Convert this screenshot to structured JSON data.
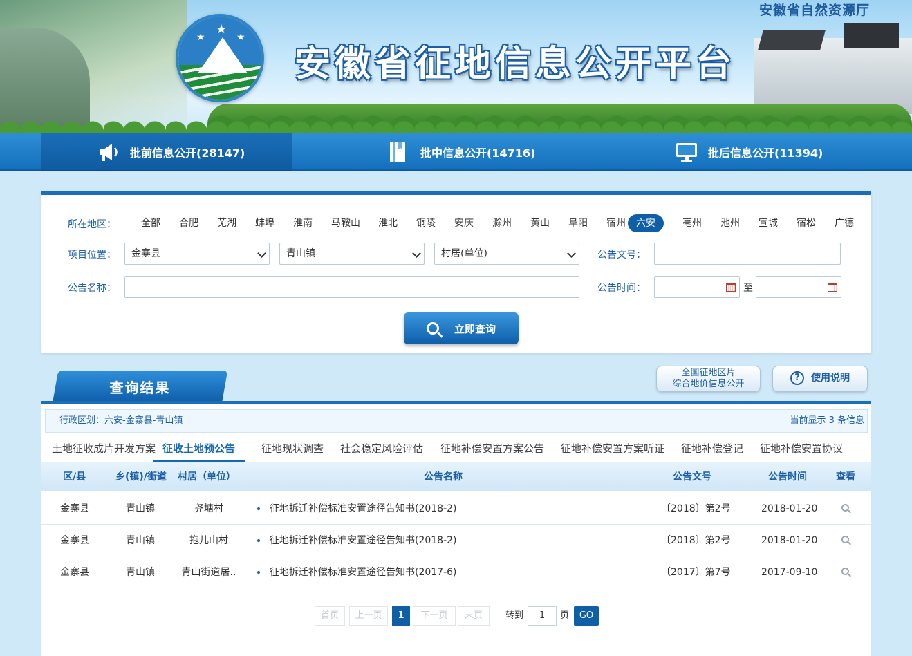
{
  "header": {
    "department": "安徽省自然资源厅",
    "site_title": "安徽省征地信息公开平台"
  },
  "nav": [
    {
      "label": "批前信息公开(28147)",
      "icon": "megaphone-icon",
      "active": true
    },
    {
      "label": "批中信息公开(14716)",
      "icon": "book-icon",
      "active": false
    },
    {
      "label": "批后信息公开(11394)",
      "icon": "monitor-icon",
      "active": false
    }
  ],
  "search": {
    "region_label": "所在地区：",
    "regions": [
      "全部",
      "合肥",
      "芜湖",
      "蚌埠",
      "淮南",
      "马鞍山",
      "淮北",
      "铜陵",
      "安庆",
      "滁州",
      "黄山",
      "阜阳",
      "宿州",
      "六安",
      "亳州",
      "池州",
      "宣城",
      "宿松",
      "广德"
    ],
    "active_region": "六安",
    "location_label": "项目位置：",
    "county": "金寨县",
    "town": "青山镇",
    "village": "村居(单位)",
    "doc_no_label": "公告文号：",
    "doc_no_value": "",
    "name_label": "公告名称：",
    "name_value": "",
    "time_label": "公告时间：",
    "time_to": "至",
    "time_from_value": "",
    "time_to_value": "",
    "button_label": "立即查询"
  },
  "results": {
    "title": "查询结果",
    "side_button_1_line1": "全国征地区片",
    "side_button_1_line2": "综合地价信息公开",
    "help_label": "使用说明",
    "region_text": "行政区划：六安-金寨县-青山镇",
    "count_text": "当前显示 3 条信息",
    "tabs": [
      "土地征收成片开发方案",
      "征收土地预公告",
      "征地现状调查",
      "社会稳定风险评估",
      "征地补偿安置方案公告",
      "征地补偿安置方案听证",
      "征地补偿登记",
      "征地补偿安置协议"
    ],
    "active_tab": 1,
    "columns": {
      "county": "区/县",
      "town": "乡(镇)/街道",
      "village": "村居（单位）",
      "name": "公告名称",
      "doc": "公告文号",
      "date": "公告时间",
      "view": "查看"
    },
    "rows": [
      {
        "county": "金寨县",
        "town": "青山镇",
        "village": "尧塘村",
        "name": "征地拆迁补偿标准安置途径告知书(2018-2)",
        "doc": "〔2018〕第2号",
        "date": "2018-01-20"
      },
      {
        "county": "金寨县",
        "town": "青山镇",
        "village": "抱儿山村",
        "name": "征地拆迁补偿标准安置途径告知书(2018-2)",
        "doc": "〔2018〕第2号",
        "date": "2018-01-20"
      },
      {
        "county": "金寨县",
        "town": "青山镇",
        "village": "青山街道居..",
        "name": "征地拆迁补偿标准安置途径告知书(2017-6)",
        "doc": "〔2017〕第7号",
        "date": "2017-09-10"
      }
    ]
  },
  "pager": {
    "first": "首页",
    "prev": "上一页",
    "current": "1",
    "next": "下一页",
    "last": "末页",
    "goto_label": "转到",
    "page_value": "1",
    "page_unit": "页",
    "go": "GO"
  }
}
